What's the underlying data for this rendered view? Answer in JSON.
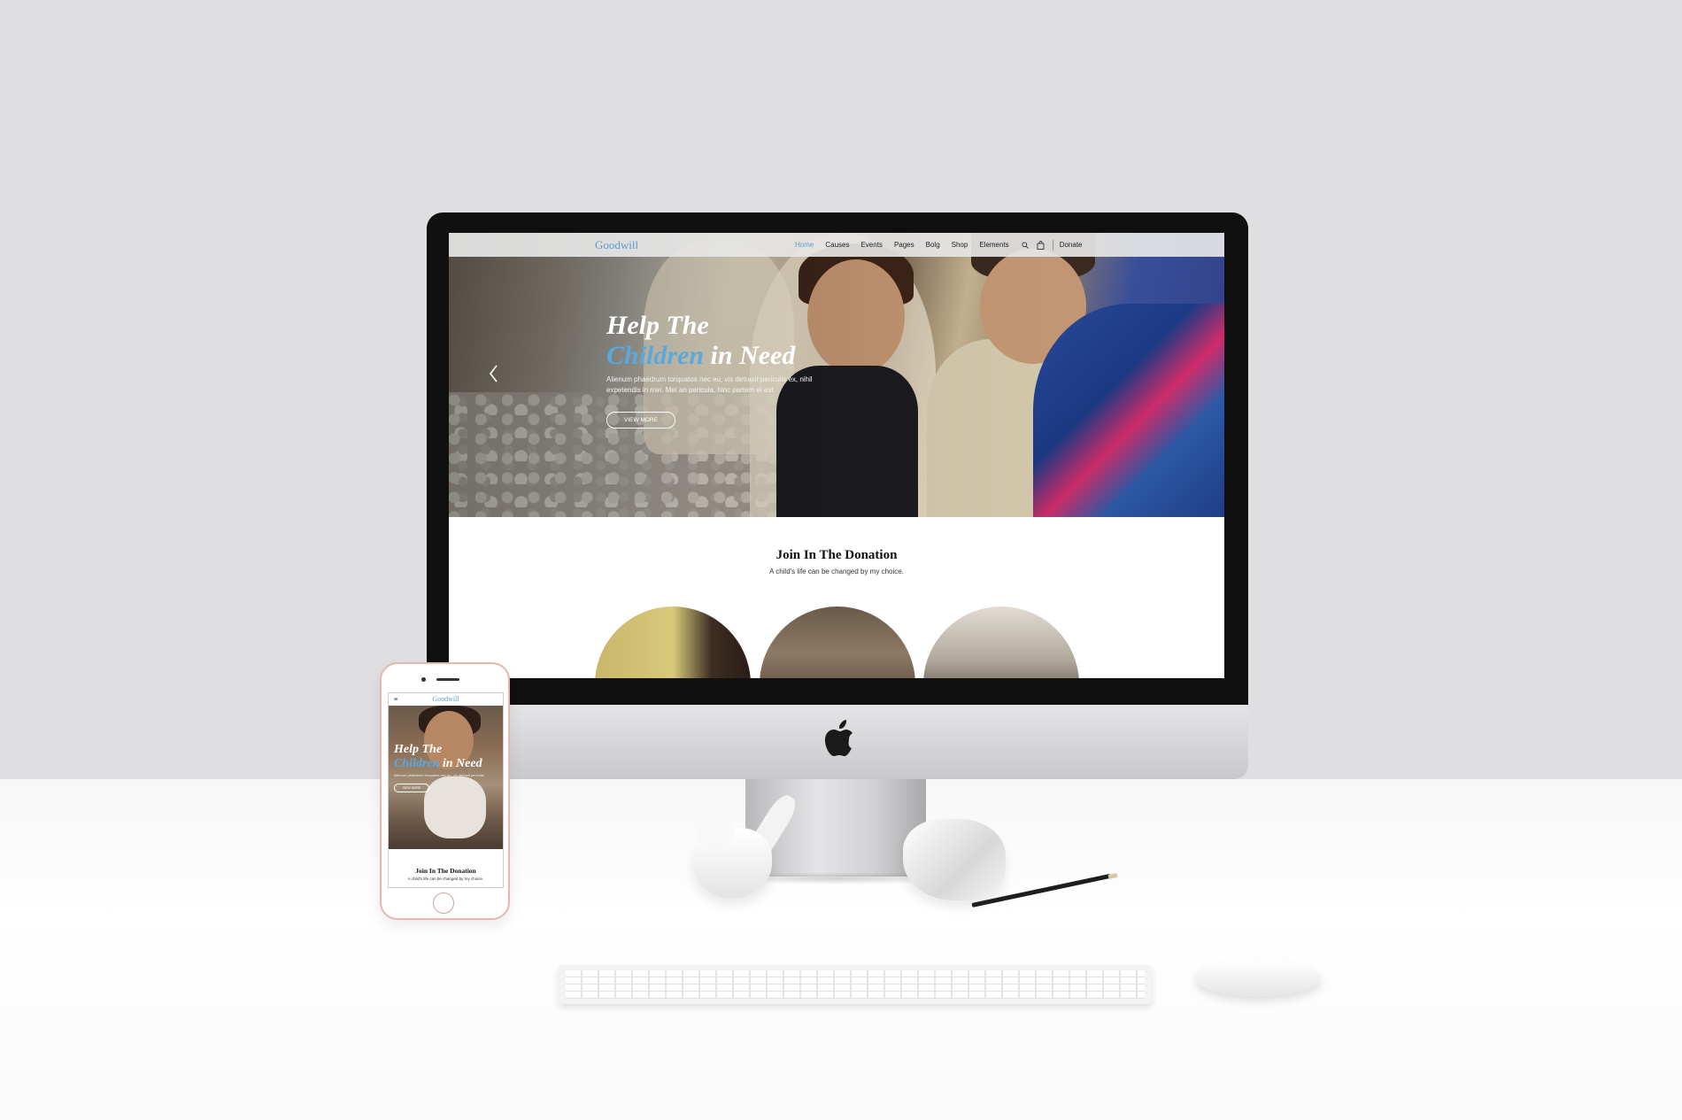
{
  "site": {
    "logo": "Goodwill",
    "nav": [
      "Home",
      "Causes",
      "Events",
      "Pages",
      "Bolg",
      "Shop",
      "Elements"
    ],
    "donate_label": "Donate",
    "accent_color": "#5a9fd0",
    "icons": [
      "search-icon",
      "cart-icon",
      "chevron-left-icon"
    ]
  },
  "hero": {
    "title_line1": "Help The",
    "title_line2_blue": "Children",
    "title_line2_rest": " in Need",
    "description": "Alienum phaedrum torquatos nec eu, vis detraxit periculis ex, nihil expetendis in mei. Mei an pericula, hinc partem ei est.",
    "button_label": "VIEW MORE"
  },
  "donation": {
    "title": "Join In The Donation",
    "subtitle": "A child's life can be changed by my choice."
  },
  "phone": {
    "menu_icon": "≡",
    "logo": "Goodwill",
    "title_line1": "Help The",
    "title_line2_blue": "Children",
    "title_line2_rest": " in Need",
    "description": "Alienum phaedrum torquatos nec eu, vis detraxit periculis",
    "button_label": "VIEW MORE",
    "donation_title": "Join In The Donation",
    "donation_subtitle": "A child's life can be changed by my choice."
  }
}
